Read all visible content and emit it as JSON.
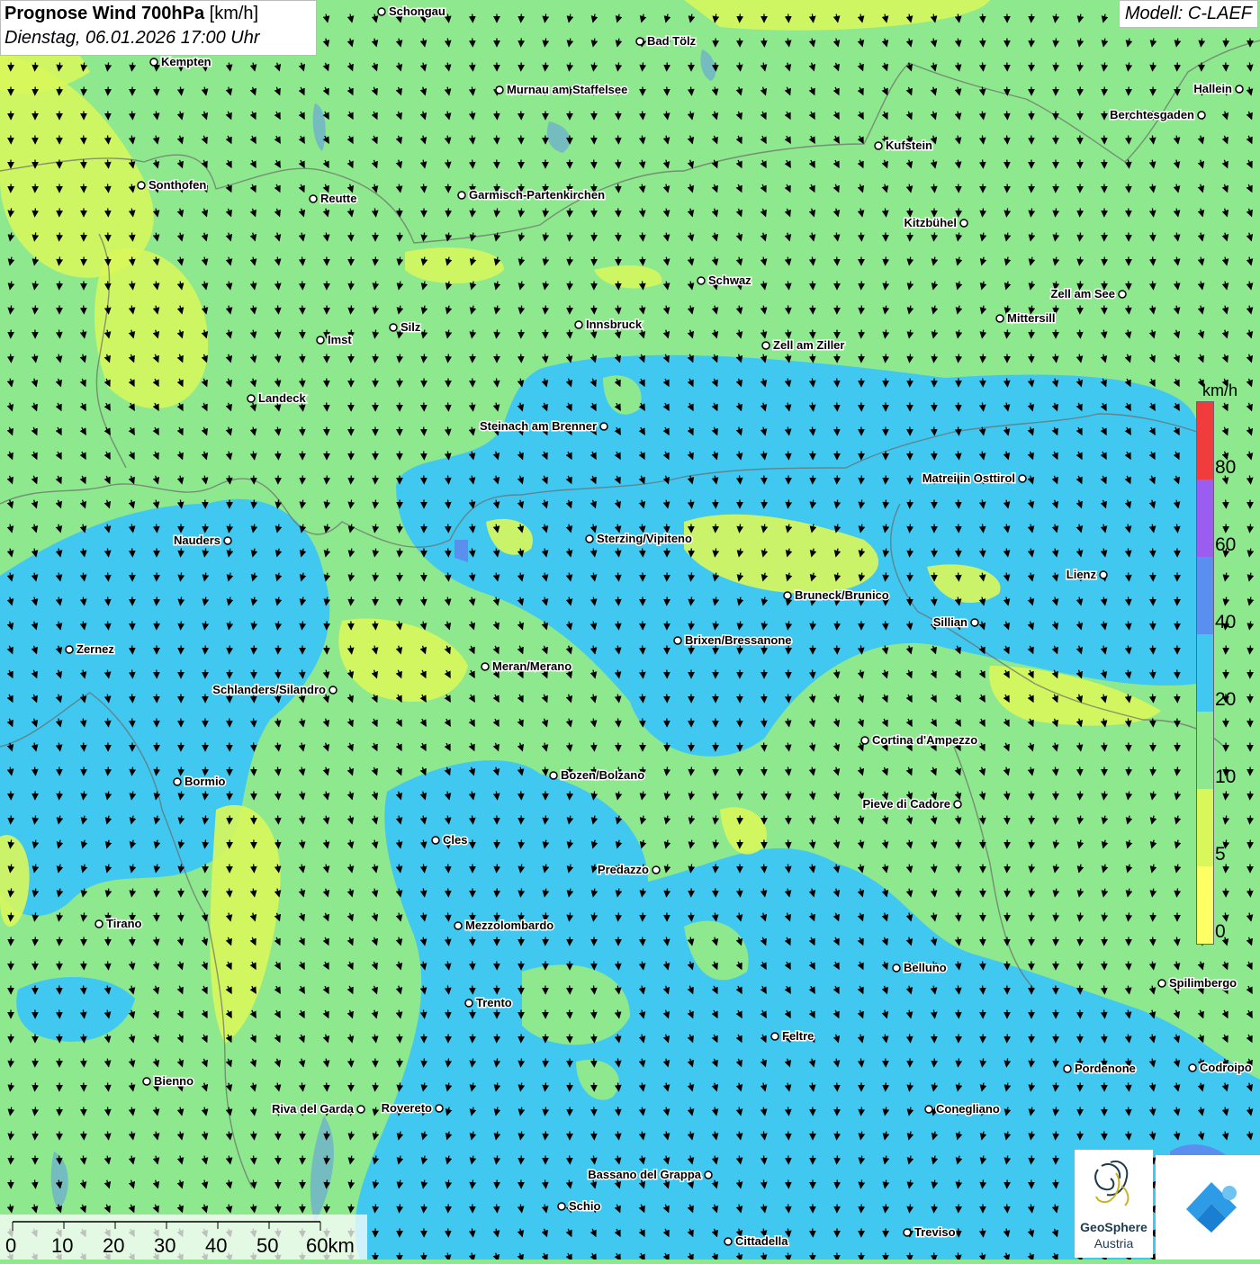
{
  "title": {
    "main": "Prognose Wind 700hPa",
    "unit": "[km/h]",
    "datetime": "Dienstag, 06.01.2026 17:00 Uhr"
  },
  "model": "Modell: C-LAEF",
  "legend": {
    "unit": "km/h",
    "ticks": [
      "80",
      "60",
      "40",
      "20",
      "10",
      "5",
      "0"
    ],
    "colors": [
      "#ffff66",
      "#d9f75a",
      "#8ee88e",
      "#40c8f0",
      "#5a8ff0",
      "#9b5cf0",
      "#f03c3c"
    ]
  },
  "scalebar": {
    "labels": [
      "0",
      "10",
      "20",
      "30",
      "40",
      "50",
      "60km"
    ]
  },
  "logos": {
    "geosphere_line1": "GeoSphere",
    "geosphere_line2": "Austria",
    "geosphere_icon": "geosphere-swirl-icon",
    "app_icon": "warning-app-icon"
  },
  "cities": [
    "Schongau",
    "Bad Tölz",
    "Kempten",
    "Murnau am Staffelsee",
    "Hallein",
    "Berchtesgaden",
    "Kufstein",
    "Sonthofen",
    "Reutte",
    "Garmisch-Partenkirchen",
    "Kitzbühel",
    "Schwaz",
    "Zell am See",
    "Mittersill",
    "Silz",
    "Innsbruck",
    "Imst",
    "Zell am Ziller",
    "Landeck",
    "Steinach am Brenner",
    "Matrei in Osttirol",
    "Nauders",
    "Sterzing/Vipiteno",
    "Lienz",
    "Bruneck/Brunico",
    "Sillian",
    "Zernez",
    "Brixen/Bressanone",
    "Meran/Merano",
    "Schlanders/Silandro",
    "Cortina d'Ampezzo",
    "Bozen/Bolzano",
    "Bormio",
    "Pieve di Cadore",
    "Cles",
    "Predazzo",
    "Tirano",
    "Mezzolombardo",
    "Belluno",
    "Spilimbergo",
    "Trento",
    "Feltre",
    "Bienno",
    "Pordenone",
    "Codroipo",
    "Riva del Garda",
    "Rovereto",
    "Conegliano",
    "Bassano del Grappa",
    "Schio",
    "Treviso",
    "Cittadella"
  ]
}
